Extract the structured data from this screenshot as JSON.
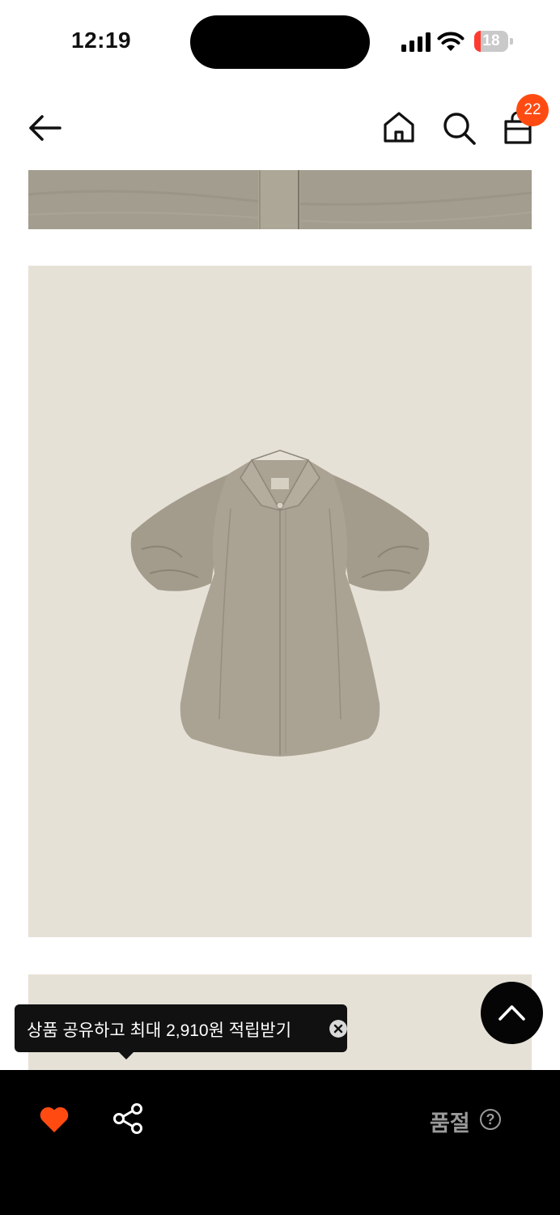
{
  "status_bar": {
    "time": "12:19",
    "battery_level": "18",
    "battery_fraction": 0.18,
    "icons": [
      "signal-icon",
      "wifi-icon",
      "battery-charging-icon"
    ]
  },
  "nav": {
    "icons": [
      "arrow-left-icon",
      "home-icon",
      "search-icon",
      "shopping-bag-icon"
    ],
    "cart_count": "22"
  },
  "tooltip": {
    "text": "상품 공유하고 최대 2,910원 적립받기",
    "close_icon": "close-circle-icon"
  },
  "bottom_bar": {
    "status_label": "품절",
    "help_glyph": "?",
    "icons": [
      "heart-icon",
      "share-icon",
      "help-circle-icon"
    ]
  },
  "colors": {
    "accent": "#ff4b12",
    "heart": "#ff4b12",
    "bottom_bar": "#000000",
    "product_background": "#e6e1d7",
    "shirt": "#a9a292"
  },
  "scroll_top": {
    "icon": "chevron-up-icon"
  }
}
